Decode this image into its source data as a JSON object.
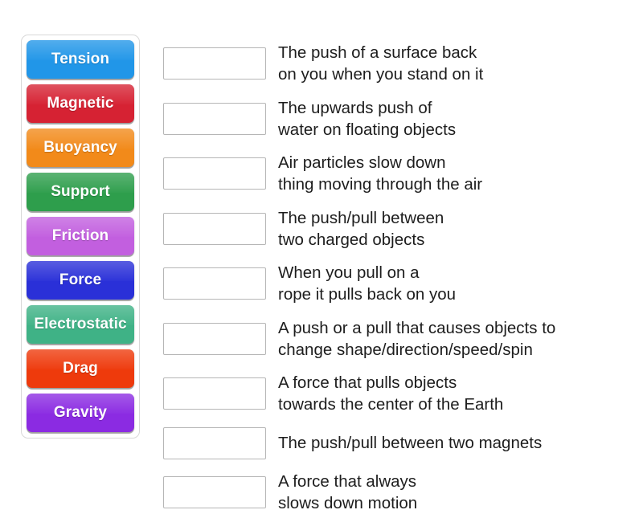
{
  "activity": {
    "type": "match-up",
    "tiles_panel": {
      "tiles": [
        {
          "label": "Tension",
          "color": "#2196E8"
        },
        {
          "label": "Magnetic",
          "color": "#D62233"
        },
        {
          "label": "Buoyancy",
          "color": "#F28A1A"
        },
        {
          "label": "Support",
          "color": "#2E9E4C"
        },
        {
          "label": "Friction",
          "color": "#C25FDF"
        },
        {
          "label": "Force",
          "color": "#2A30D8"
        },
        {
          "label": "Electrostatic",
          "color": "#3FB286"
        },
        {
          "label": "Drag",
          "color": "#EE3A0C"
        },
        {
          "label": "Gravity",
          "color": "#8B2BE2"
        }
      ]
    },
    "pairs": [
      {
        "answer": "",
        "definition": "The push of a surface back\non you when you stand on it"
      },
      {
        "answer": "",
        "definition": "The upwards push of\nwater on floating objects"
      },
      {
        "answer": "",
        "definition": "Air particles slow down\nthing moving through the air"
      },
      {
        "answer": "",
        "definition": "The push/pull between\ntwo charged objects"
      },
      {
        "answer": "",
        "definition": "When you pull on a\nrope it pulls back on you"
      },
      {
        "answer": "",
        "definition": "A push or a pull that causes objects to\nchange shape/direction/speed/spin"
      },
      {
        "answer": "",
        "definition": "A force that pulls objects\ntowards the center of the Earth"
      },
      {
        "answer": "",
        "definition": "The push/pull between two magnets"
      },
      {
        "answer": "",
        "definition": "A force that always\nslows down motion"
      }
    ]
  }
}
